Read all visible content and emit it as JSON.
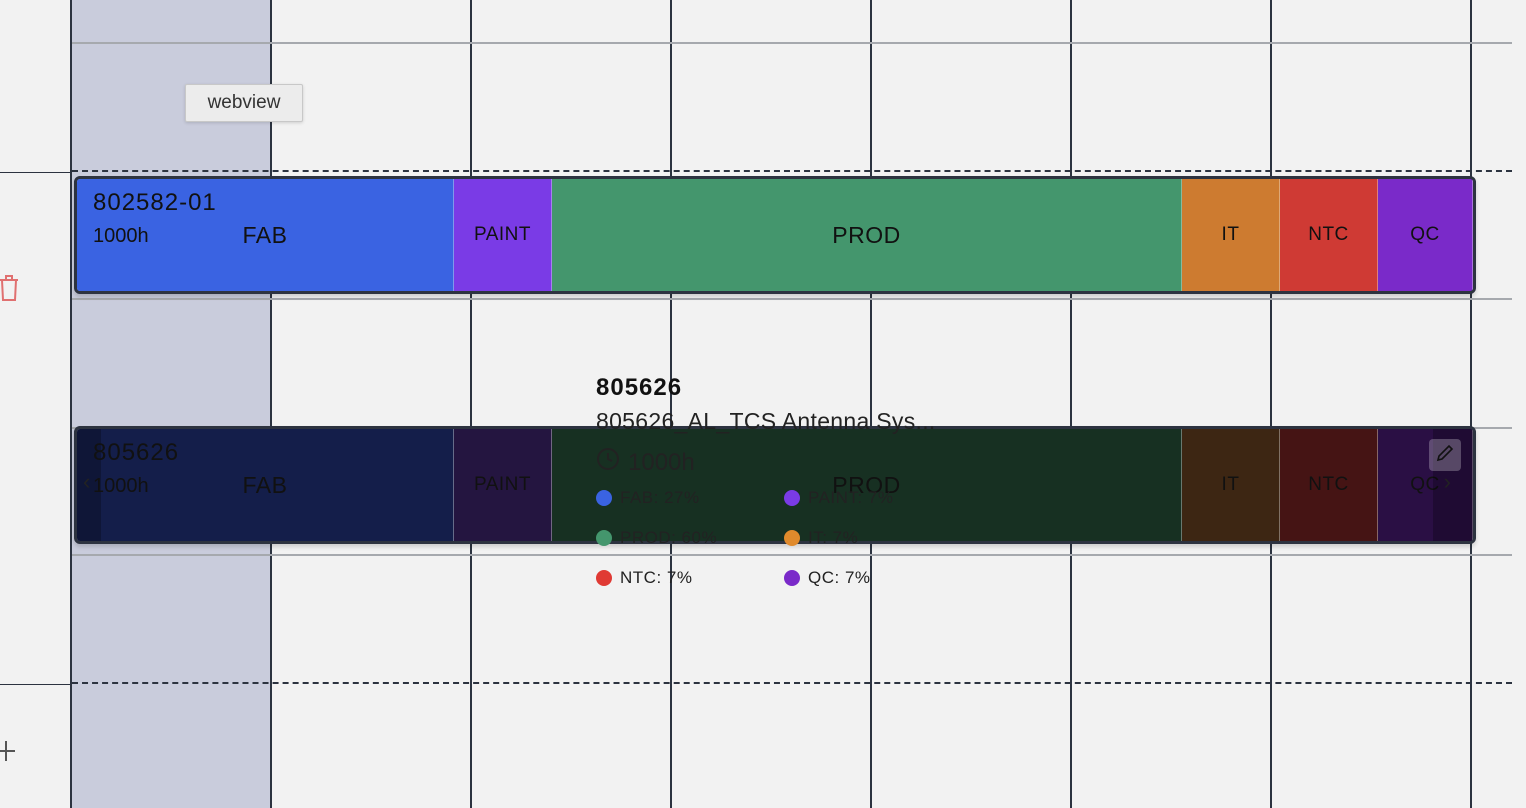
{
  "tooltip": {
    "label": "webview"
  },
  "jobs": [
    {
      "id": "802582-01",
      "hours": "1000h",
      "segments": [
        {
          "label": "FAB",
          "color": "#3a63e2"
        },
        {
          "label": "PAINT",
          "color": "#7a3be6"
        },
        {
          "label": "PROD",
          "color": "#44966d"
        },
        {
          "label": "IT",
          "color": "#cd7b30"
        },
        {
          "label": "NTC",
          "color": "#cf3a34"
        },
        {
          "label": "QC",
          "color": "#7a2ac9"
        }
      ]
    },
    {
      "id": "805626",
      "hours": "1000h",
      "segments": [
        {
          "label": "FAB",
          "color": "#141e4a"
        },
        {
          "label": "PAINT",
          "color": "#241540"
        },
        {
          "label": "PROD",
          "color": "#173022"
        },
        {
          "label": "IT",
          "color": "#3d2613"
        },
        {
          "label": "NTC",
          "color": "#451414"
        },
        {
          "label": "QC",
          "color": "#2a0f44"
        }
      ]
    }
  ],
  "popover": {
    "title": "805626",
    "subtitle": "805626_AL_TCS Antenna Sys...",
    "hours": "1000h",
    "breakdown": [
      {
        "label": "FAB: 27%",
        "color": "#3a63e2"
      },
      {
        "label": "PAINT: 7%",
        "color": "#7a3be6"
      },
      {
        "label": "PROD: 60%",
        "color": "#44966d"
      },
      {
        "label": "IT: 7%",
        "color": "#e08a2c"
      },
      {
        "label": "NTC: 7%",
        "color": "#e03a34"
      },
      {
        "label": "QC: 7%",
        "color": "#7a2ac9"
      }
    ]
  }
}
